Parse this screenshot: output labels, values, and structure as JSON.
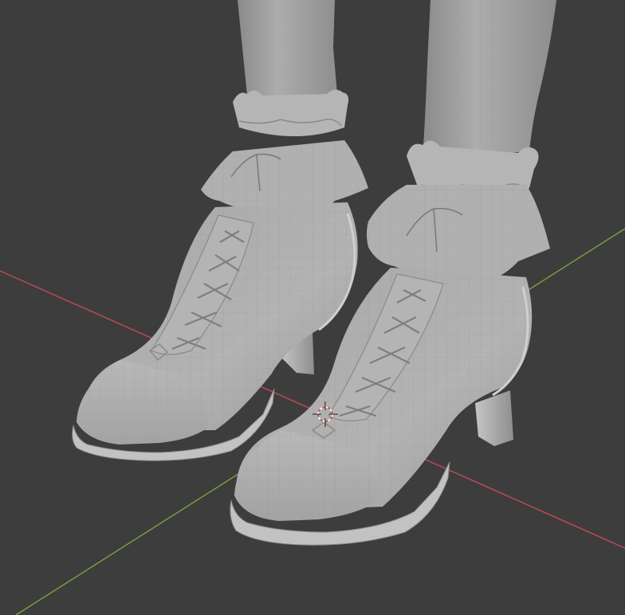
{
  "viewport": {
    "background": "#3d3d3d",
    "x_axis_color": "#c24a55",
    "y_axis_color": "#7aa53a",
    "mesh_color": "#a9a9a9",
    "mesh_shadow": "#7a7a7a",
    "mesh_highlight": "#c4c4c4",
    "wire_color": "#8c8c8c",
    "cursor_colors": [
      "#ffffff",
      "#d8383b"
    ],
    "icons": [
      "3d-cursor-icon"
    ]
  }
}
